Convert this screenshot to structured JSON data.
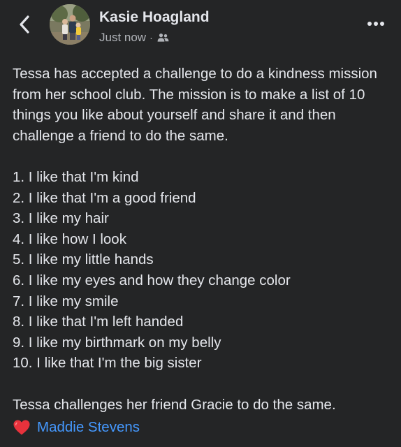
{
  "header": {
    "author_name": "Kasie Hoagland",
    "timestamp": "Just now",
    "separator": "·",
    "audience_icon": "friends-icon",
    "back_icon": "chevron-left-icon",
    "more_icon": "more-dots-icon"
  },
  "post": {
    "intro": "Tessa has accepted a challenge to do a kindness mission from her school club. The mission is to make a list of 10 things you like about yourself and share it and then challenge a friend to do the same.",
    "list": [
      "1. I like that I'm kind",
      "2. I like that I'm a good friend",
      "3. I like my hair",
      "4. I like how I look",
      "5. I like my little hands",
      "6. I like my eyes and how they change color",
      "7. I like my smile",
      "8. I like that I'm left handed",
      "9. I like my birthmark on my belly",
      "10. I like that I'm the big sister"
    ],
    "outro": "Tessa challenges her friend Gracie to do the same."
  },
  "reaction": {
    "icon": "heart-icon",
    "mention": "Maddie Stevens"
  },
  "colors": {
    "background": "#242526",
    "text": "#e4e6eb",
    "secondary_text": "#b0b3b8",
    "link": "#4599ff",
    "heart": "#e8323c"
  }
}
